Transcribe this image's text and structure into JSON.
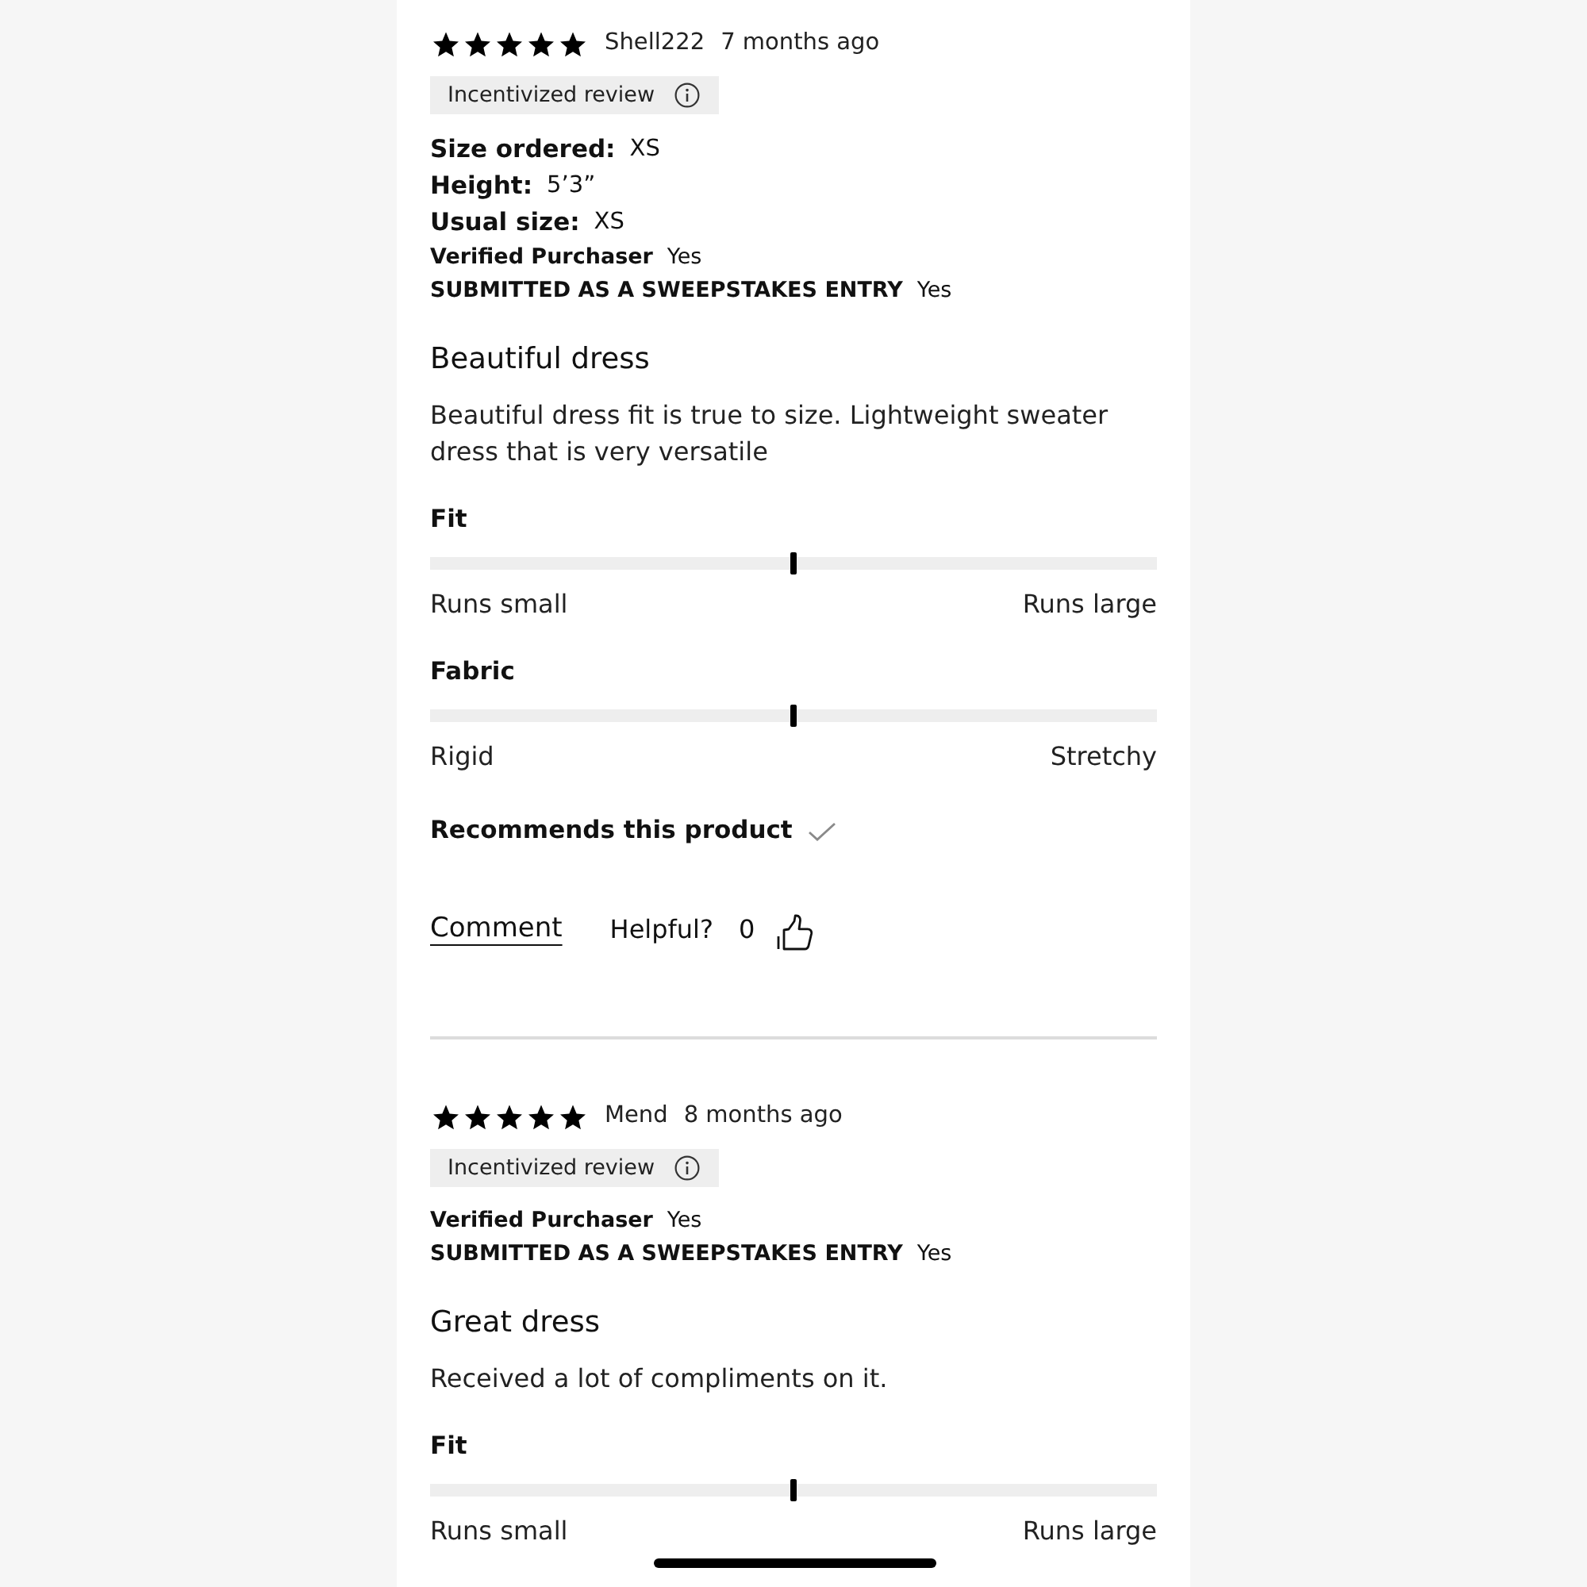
{
  "reviews": [
    {
      "stars": 5,
      "author": "Shell222",
      "date": "7 months ago",
      "badge": "Incentivized review",
      "details": [
        {
          "kind": "measure",
          "label": "Size ordered:",
          "value": "XS"
        },
        {
          "kind": "measure",
          "label": "Height:",
          "value": "5’3”"
        },
        {
          "kind": "measure",
          "label": "Usual size:",
          "value": "XS"
        },
        {
          "kind": "flag",
          "label": "Verified Purchaser",
          "value": "Yes"
        },
        {
          "kind": "flag",
          "label": "SUBMITTED AS A SWEEPSTAKES ENTRY",
          "value": "Yes"
        }
      ],
      "title": "Beautiful dress",
      "body": "Beautiful dress fit is true to size. Lightweight sweater dress that is very versatile",
      "ratings": [
        {
          "label": "Fit",
          "level": 0.5,
          "low": "Runs small",
          "high": "Runs large"
        },
        {
          "label": "Fabric",
          "level": 0.5,
          "low": "Rigid",
          "high": "Stretchy"
        }
      ],
      "recommends": {
        "label": "Recommends this product",
        "checked": true
      },
      "actions": {
        "comment": "Comment",
        "helpful_label": "Helpful?",
        "helpful_count": "0"
      }
    },
    {
      "stars": 5,
      "author": "Mend",
      "date": "8 months ago",
      "badge": "Incentivized review",
      "details": [
        {
          "kind": "flag",
          "label": "Verified Purchaser",
          "value": "Yes"
        },
        {
          "kind": "flag",
          "label": "SUBMITTED AS A SWEEPSTAKES ENTRY",
          "value": "Yes"
        }
      ],
      "title": "Great dress",
      "body": "Received a lot of compliments on it.",
      "ratings": [
        {
          "label": "Fit",
          "level": 0.5,
          "low": "Runs small",
          "high": "Runs large"
        }
      ]
    }
  ]
}
